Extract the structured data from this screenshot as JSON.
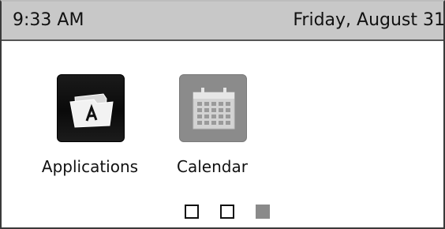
{
  "status_bar": {
    "time": "9:33 AM",
    "date": "Friday, August 31"
  },
  "apps": [
    {
      "label": "Applications",
      "icon": "folder-a-icon"
    },
    {
      "label": "Calendar",
      "icon": "calendar-icon"
    }
  ],
  "pager": {
    "pages": 3,
    "current_page": 3
  },
  "colors": {
    "status_bar_bg": "#c8c8c8",
    "active_page": "#8a8a8a",
    "calendar_tile": "#8b8b8b",
    "applications_tile": "#0a0a0a"
  }
}
